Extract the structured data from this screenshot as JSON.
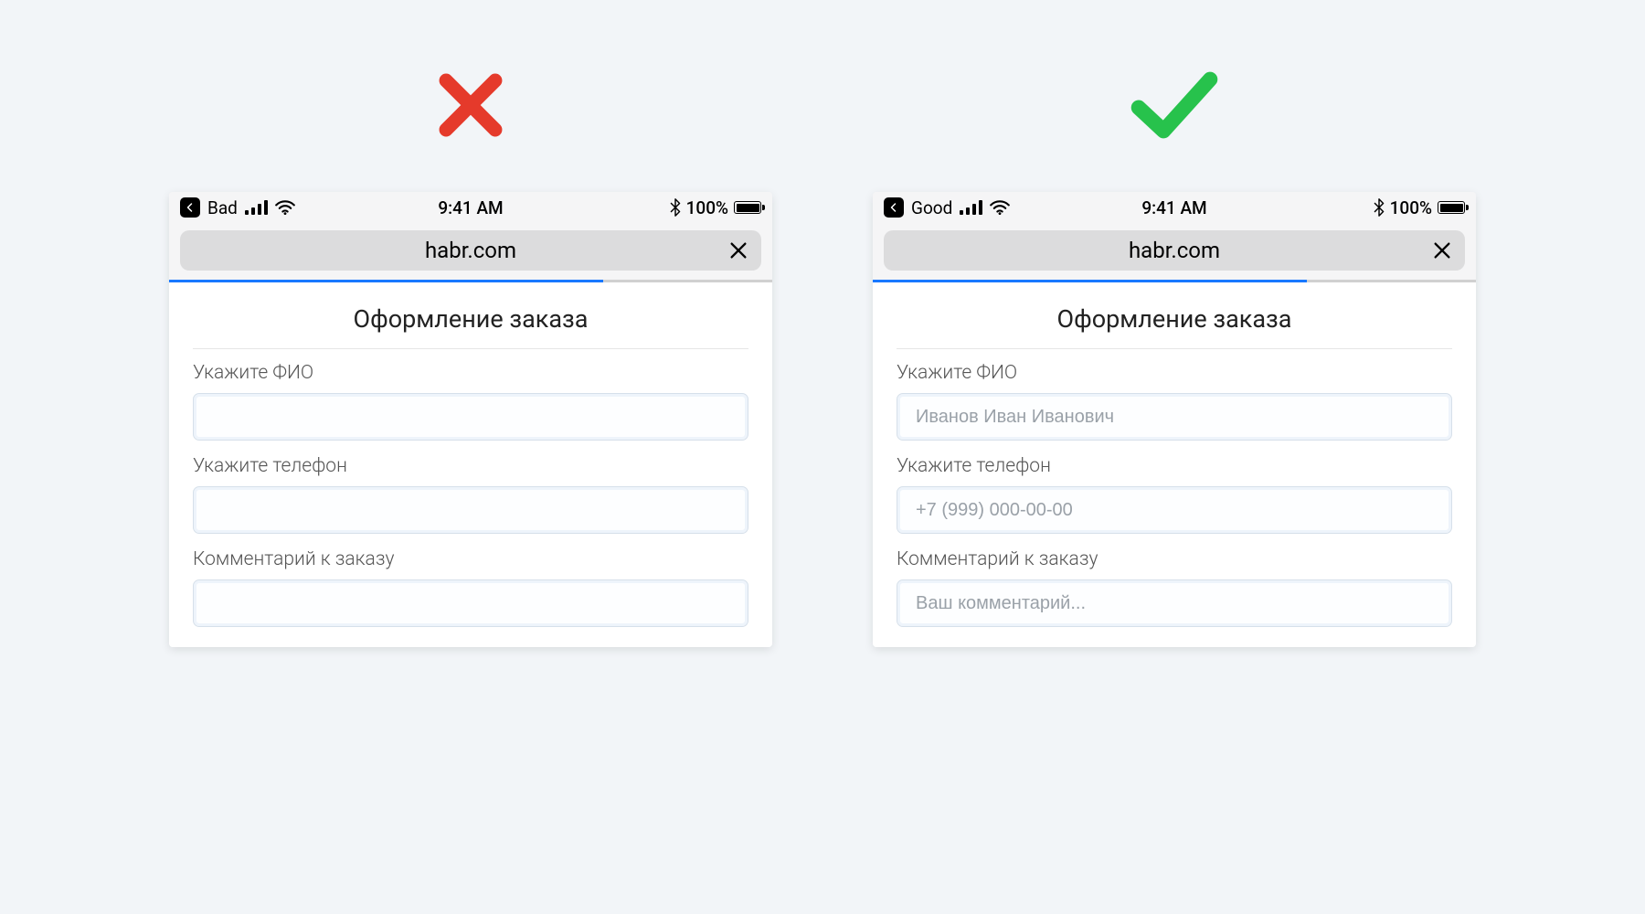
{
  "colors": {
    "bad": "#e53a2b",
    "good": "#27c24c",
    "progress": "#1878ff"
  },
  "bad": {
    "status": {
      "carrier": "Bad",
      "time": "9:41 AM",
      "battery_pct": "100%"
    },
    "url": "habr.com",
    "page": {
      "title": "Оформление заказа",
      "fields": [
        {
          "label": "Укажите ФИО",
          "placeholder": ""
        },
        {
          "label": "Укажите телефон",
          "placeholder": ""
        },
        {
          "label": "Комментарий к заказу",
          "placeholder": ""
        }
      ]
    }
  },
  "good": {
    "status": {
      "carrier": "Good",
      "time": "9:41 AM",
      "battery_pct": "100%"
    },
    "url": "habr.com",
    "page": {
      "title": "Оформление заказа",
      "fields": [
        {
          "label": "Укажите ФИО",
          "placeholder": "Иванов Иван Иванович"
        },
        {
          "label": "Укажите телефон",
          "placeholder": "+7 (999) 000-00-00"
        },
        {
          "label": "Комментарий к заказу",
          "placeholder": "Ваш комментарий..."
        }
      ]
    }
  }
}
